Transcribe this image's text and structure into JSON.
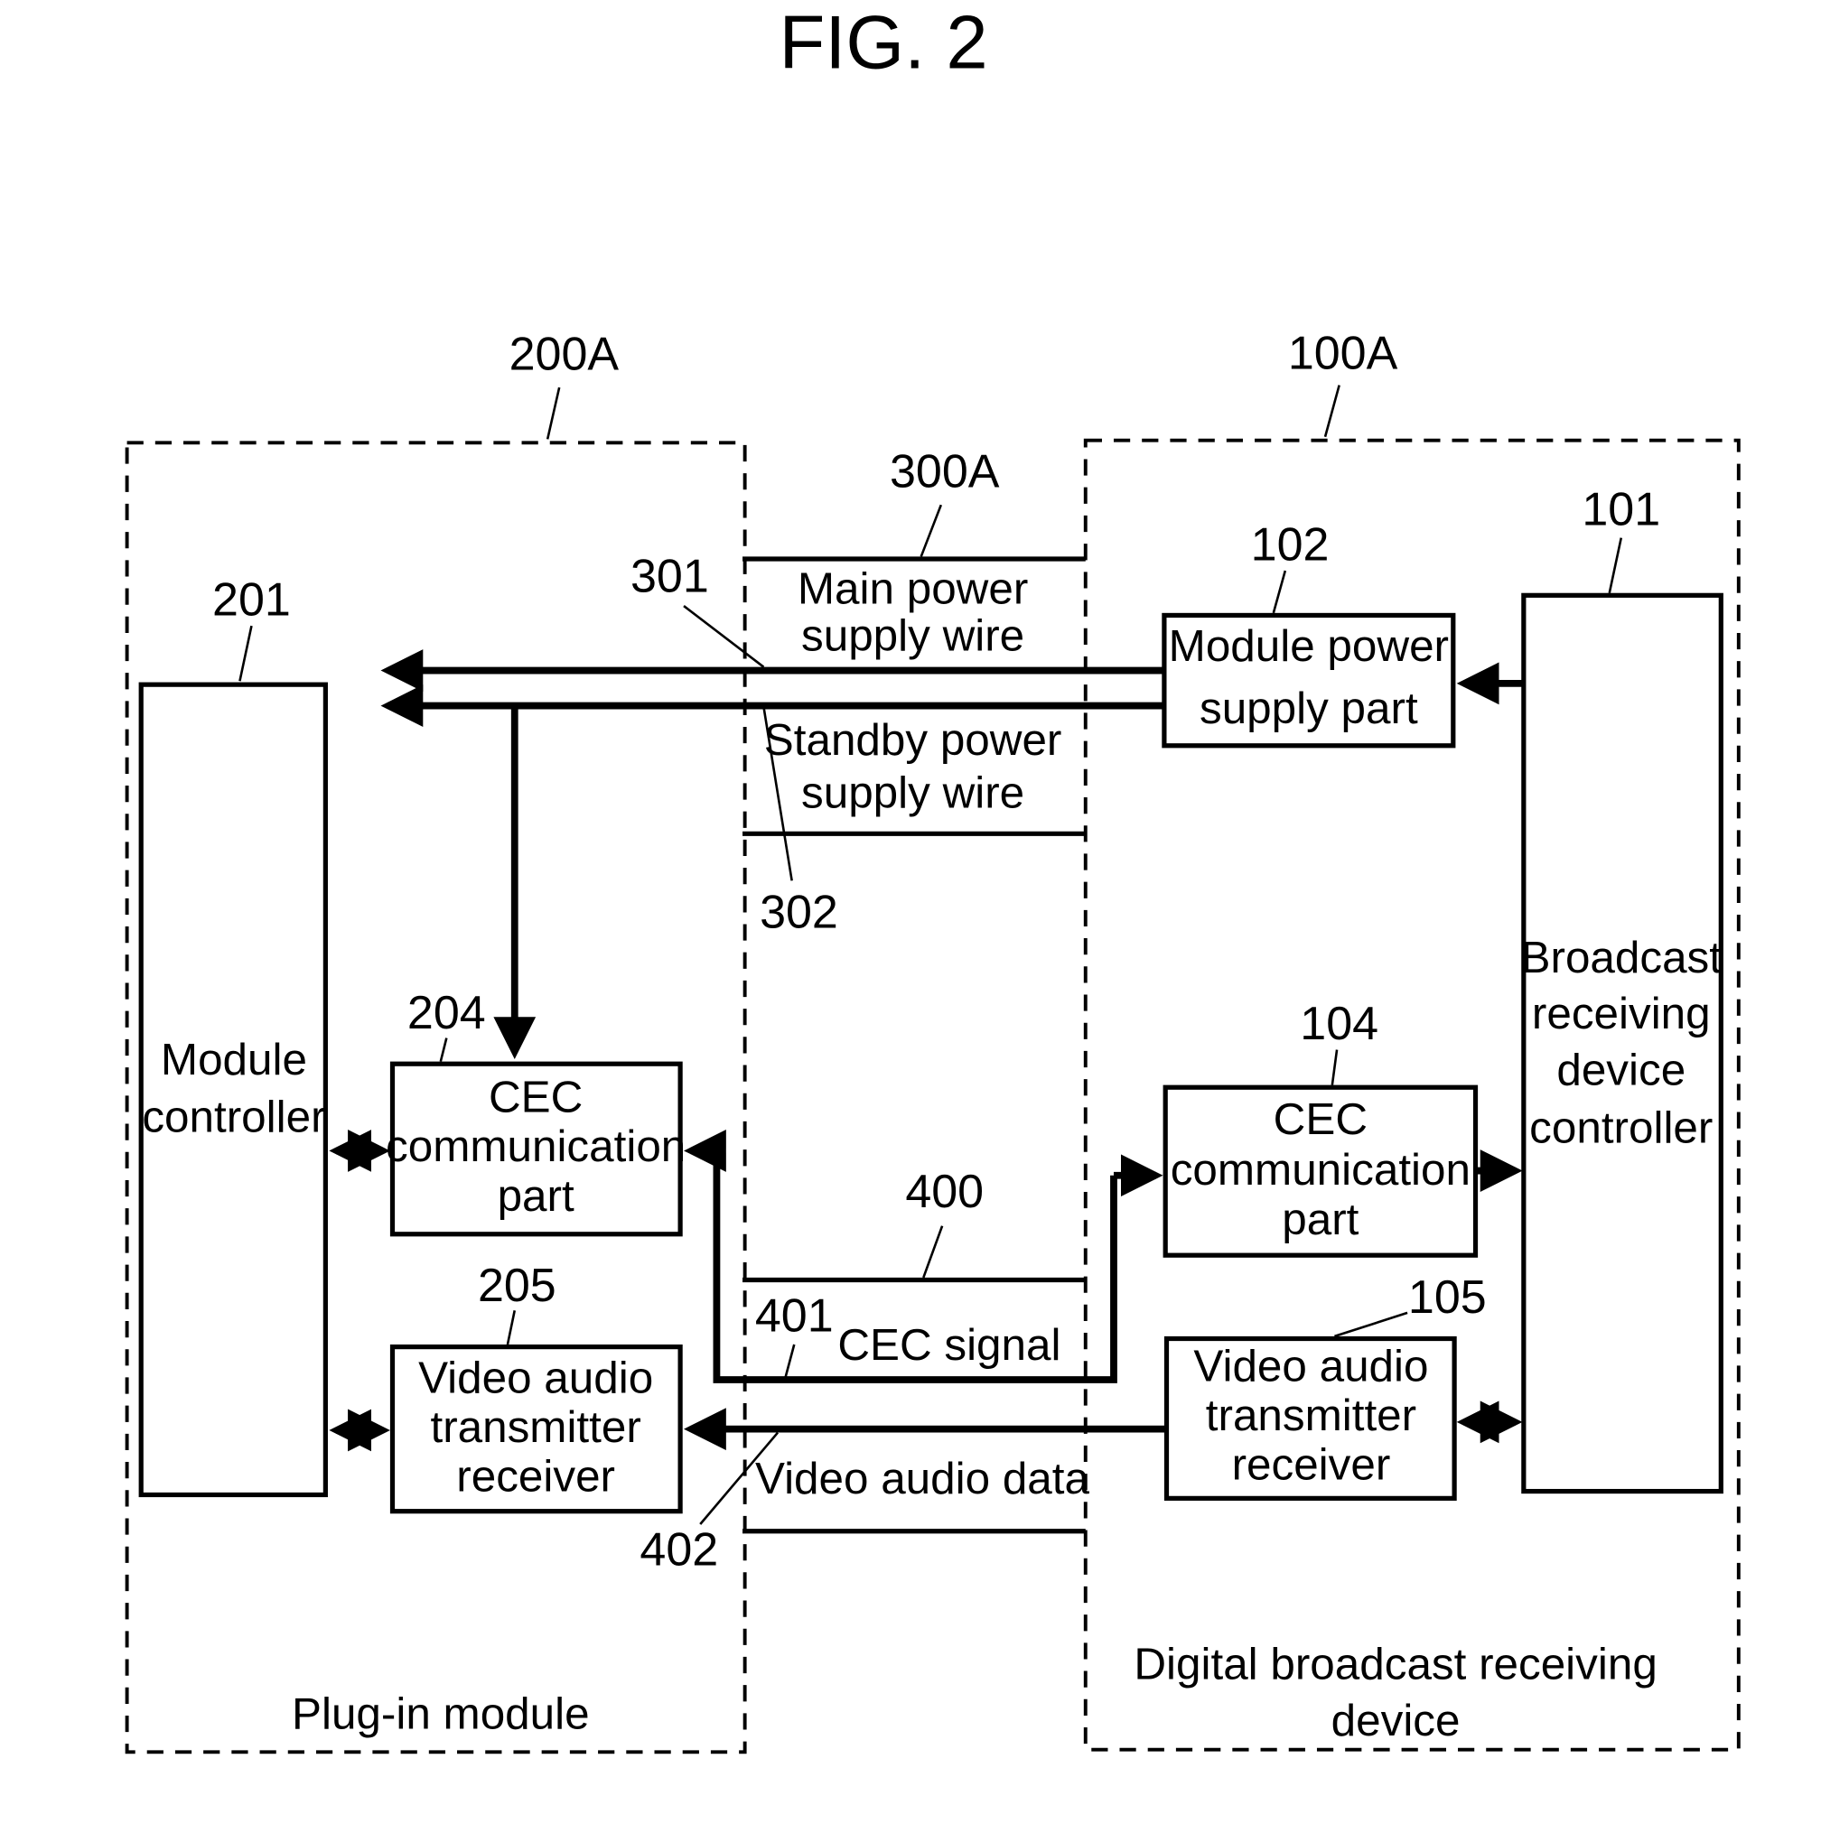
{
  "figure": {
    "title": "FIG. 2",
    "colors": {
      "ink": "#000000",
      "background": "#ffffff"
    }
  },
  "plugin_module": {
    "ref": "200A",
    "label": "Plug-in module",
    "module_controller": {
      "ref": "201",
      "lines": [
        "Module",
        "controller"
      ]
    },
    "cec_part": {
      "ref": "204",
      "lines": [
        "CEC",
        "communication",
        "part"
      ]
    },
    "video_audio": {
      "ref": "205",
      "lines": [
        "Video audio",
        "transmitter",
        "receiver"
      ]
    }
  },
  "interface": {
    "ref": "300A",
    "main_power": {
      "ref": "301",
      "lines": [
        "Main power",
        "supply wire"
      ]
    },
    "standby_power": {
      "ref": "302",
      "lines": [
        "Standby power",
        "supply wire"
      ]
    },
    "cec_group_ref": "400",
    "cec_signal": {
      "ref": "401",
      "label": "CEC signal"
    },
    "video_audio_data": {
      "ref": "402",
      "label": "Video audio data"
    }
  },
  "receiving_device": {
    "ref": "100A",
    "label_lines": [
      "Digital broadcast receiving",
      "device"
    ],
    "controller": {
      "ref": "101",
      "lines": [
        "Broadcast",
        "receiving",
        "device",
        "controller"
      ]
    },
    "module_power": {
      "ref": "102",
      "lines": [
        "Module power",
        "supply part"
      ]
    },
    "cec_part": {
      "ref": "104",
      "lines": [
        "CEC",
        "communication",
        "part"
      ]
    },
    "video_audio": {
      "ref": "105",
      "lines": [
        "Video audio",
        "transmitter",
        "receiver"
      ]
    }
  }
}
